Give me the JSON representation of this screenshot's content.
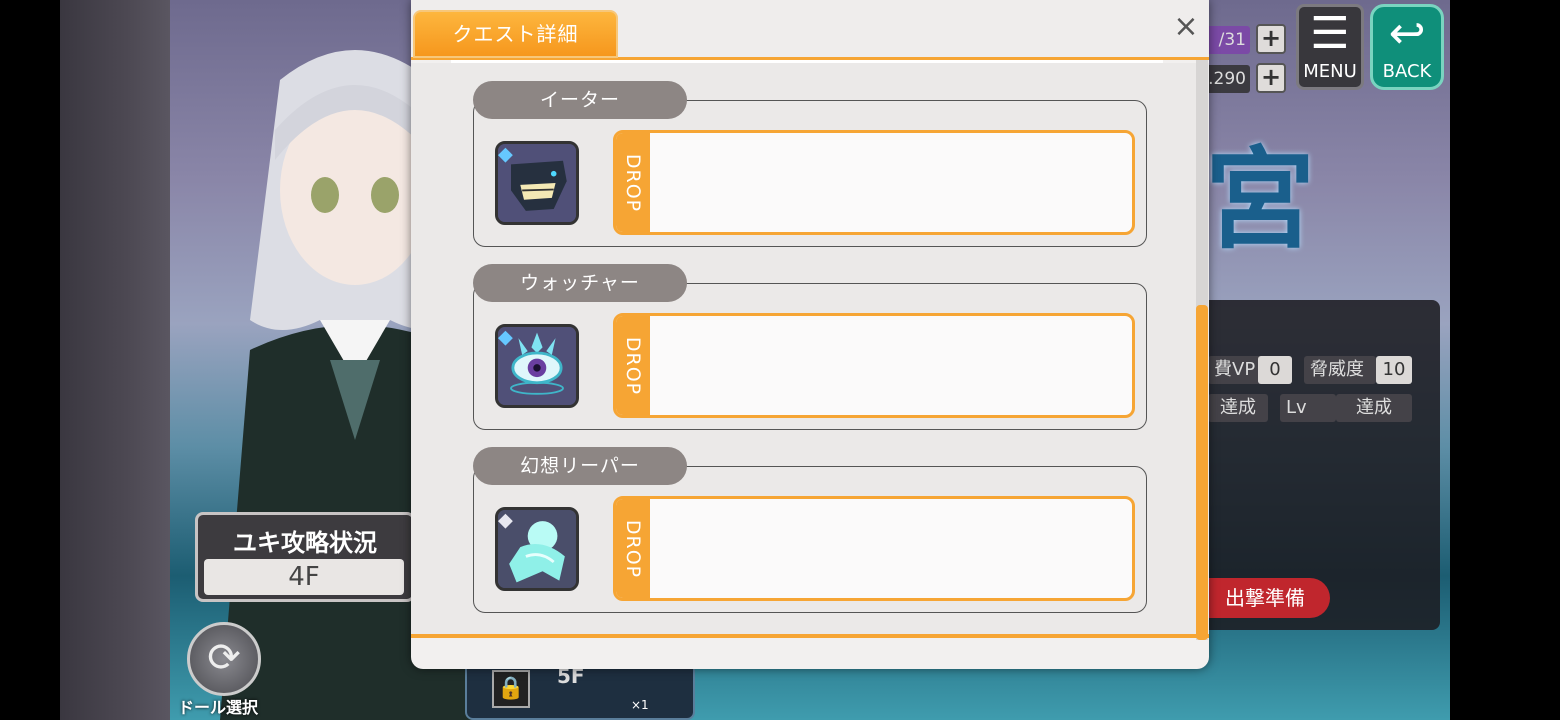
{
  "background": {
    "status_title": "ユキ攻略状況",
    "status_value": "4F",
    "refresh_label": "ドール選択",
    "floor_label": "5F",
    "floor_count": "×1",
    "resource_1": "/31",
    "resource_2": ".290",
    "menu_label": "MENU",
    "back_label": "BACK",
    "panel": {
      "vp_label": "費VP",
      "vp_value": "0",
      "threat_label": "脅威度",
      "threat_value": "10",
      "achieve_1": "達成",
      "lv_label": "Lv",
      "achieve_2": "達成",
      "sortie_label": "出撃準備"
    }
  },
  "dialog": {
    "title": "クエスト詳細",
    "close_symbol": "×",
    "enemies": [
      {
        "name": "イーター",
        "drop_label": "DROP",
        "icon": "eater-monster-icon"
      },
      {
        "name": "ウォッチャー",
        "drop_label": "DROP",
        "icon": "watcher-eye-icon"
      },
      {
        "name": "幻想リーパー",
        "drop_label": "DROP",
        "icon": "phantom-reaper-icon"
      }
    ]
  },
  "colors": {
    "accent": "#f6a534",
    "tab_gradient_top": "#fdb63e",
    "name_pill": "#8d8684",
    "dialog_bg": "#ebe9e8"
  }
}
